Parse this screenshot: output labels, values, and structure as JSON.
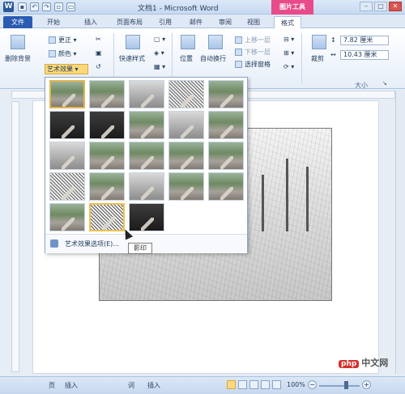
{
  "window": {
    "title": "文档1 - Microsoft Word",
    "app_icon_letter": "W",
    "tools_tab": "图片工具"
  },
  "quick_access": [
    "save",
    "undo",
    "redo",
    "open",
    "new"
  ],
  "tabs": {
    "file": "文件",
    "items": [
      "开始",
      "插入",
      "页面布局",
      "引用",
      "邮件",
      "审阅",
      "视图"
    ],
    "active": "格式"
  },
  "ribbon": {
    "remove_background": "删除背景",
    "corrections": "更正",
    "color": "颜色",
    "artistic_effects": "艺术效果",
    "quick_styles": "快速样式",
    "position": "位置",
    "wrap_text": "自动换行",
    "bring_forward": "上移一层",
    "send_backward": "下移一层",
    "selection_pane": "选择窗格",
    "crop": "裁剪",
    "height_value": "7.82 厘米",
    "width_value": "10.43 厘米",
    "size_group": "大小"
  },
  "gallery": {
    "rows": 5,
    "columns": 5,
    "count": 23,
    "options_link": "艺术效果选项(E)...",
    "hover_tooltip": "影印"
  },
  "statusbar": {
    "left_labels": [
      "页",
      "插入"
    ],
    "mid_labels": [
      "词",
      "插入"
    ],
    "zoom": "100%"
  },
  "watermark": {
    "badge": "php",
    "text": "中文网"
  }
}
